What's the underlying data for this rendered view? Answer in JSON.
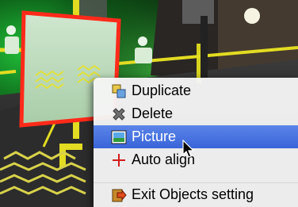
{
  "context_menu": {
    "items": [
      {
        "label": "Duplicate",
        "icon": "duplicate-icon"
      },
      {
        "label": "Delete",
        "icon": "delete-icon"
      },
      {
        "label": "Picture",
        "icon": "picture-icon",
        "selected": true
      },
      {
        "label": "Auto align",
        "icon": "auto-align-icon"
      },
      {
        "label": "Exit Objects setting",
        "icon": "exit-objects-icon"
      }
    ]
  },
  "colors": {
    "selection": "#3964d9",
    "menu_bg": "#f5f5f5",
    "panel_border": "#ff2a1a"
  }
}
